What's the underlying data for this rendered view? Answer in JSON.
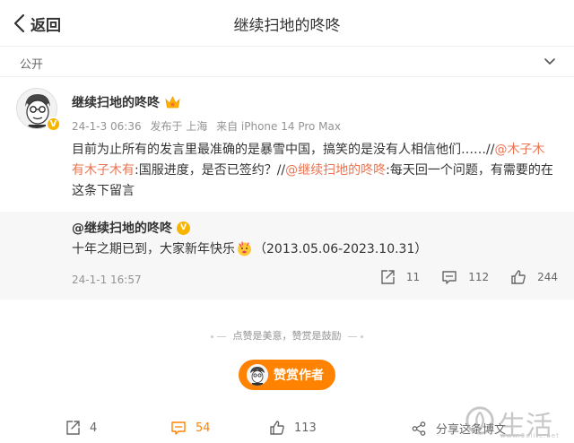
{
  "nav": {
    "back_label": "返回",
    "title": "继续扫地的咚咚"
  },
  "scope": {
    "label": "公开"
  },
  "post": {
    "author": "继续扫地的咚咚",
    "date": "24-1-3 06:36",
    "location": "发布于 上海",
    "device": "来自 iPhone 14 Pro Max",
    "text_part1": "目前为止所有的发言里最准确的是暴雪中国，搞笑的是没有人相信他们……//",
    "mention1": "@木子木有木子木有",
    "text_part2": ":国服进度，是否已签约？//",
    "mention2": "@继续扫地的咚咚",
    "text_part3": ":每天回一个问题，有需要的在这条下留言"
  },
  "quote": {
    "author": "@继续扫地的咚咚",
    "text_before": "十年之期已到，大家新年快乐",
    "text_after": "（2013.05.06-2023.10.31）",
    "time": "24-1-1 16:57",
    "reposts": "11",
    "comments": "112",
    "likes": "244"
  },
  "reward": {
    "message": "点赞是美意，赞赏是鼓励",
    "button_label": "赞赏作者"
  },
  "toolbar": {
    "reposts": "4",
    "comments": "54",
    "likes": "113",
    "share_label": "分享这条博文"
  },
  "watermark": {
    "text": "生活",
    "url": "www.3elife.net"
  },
  "colors": {
    "accent": "#ff8200",
    "link": "#eb7350",
    "verified": "#f7b500"
  }
}
